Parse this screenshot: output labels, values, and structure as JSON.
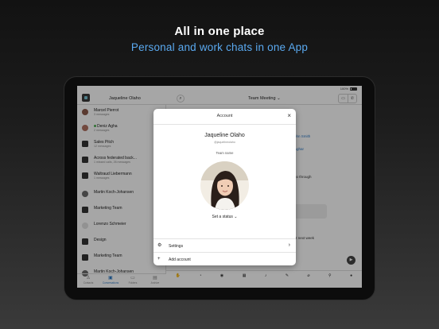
{
  "hero": {
    "title": "All in one place",
    "subtitle": "Personal and work chats in one App"
  },
  "colors": {
    "accent": "#5aa9f0",
    "link": "#2b78c5"
  },
  "status_bar": {
    "battery": "100%"
  },
  "topbar": {
    "user_name": "Jaqueline Olaho",
    "search_icon": "search-icon",
    "channel": "Team Meeting",
    "channel_chevron": "⌄",
    "video_icon": "video-icon",
    "call_icon": "phone-icon"
  },
  "conversations": [
    {
      "title": "Marcel Pierrot",
      "subtitle": "3 messages"
    },
    {
      "title": "Deniz Agha",
      "subtitle": "2 messages"
    },
    {
      "title": "Sales Pitch",
      "subtitle": "12 messages"
    },
    {
      "title": "Across federated back...",
      "subtitle": "1 missed calls, 26 messages"
    },
    {
      "title": "Waltraud Liebermann",
      "subtitle": "1 messages"
    },
    {
      "title": "Martin Koch-Johansen",
      "subtitle": ""
    },
    {
      "title": "Marketing Team",
      "subtitle": ""
    },
    {
      "title": "Lorenzo Schmeier",
      "subtitle": ""
    },
    {
      "title": "Design",
      "subtitle": ""
    },
    {
      "title": "Marketing Team",
      "subtitle": ""
    },
    {
      "title": "Martin Koch-Johansen",
      "subtitle": ""
    }
  ],
  "chat_fragments": {
    "f1": "ohn Smith",
    "f2": "Aghar",
    "f3": "go through",
    "f4": "xt next week"
  },
  "bottom_tabs": [
    {
      "label": "Contacts",
      "icon": "contacts-icon"
    },
    {
      "label": "Conversations",
      "icon": "conversations-icon"
    },
    {
      "label": "Folders",
      "icon": "folders-icon"
    },
    {
      "label": "Archive",
      "icon": "archive-icon"
    }
  ],
  "composer_toolbar": [
    "ping-icon",
    "timer-icon",
    "camera-icon",
    "gif-icon",
    "mic-icon",
    "sketch-icon",
    "attach-icon",
    "location-icon",
    "more-icon"
  ],
  "modal": {
    "title": "Account",
    "close_icon": "close-icon",
    "name": "Jaqueline Olaho",
    "handle": "@jaquelineolaho",
    "team_label": "Team name",
    "status_button": "Set a status",
    "rows": {
      "settings": "Settings",
      "add_account": "Add account"
    }
  }
}
